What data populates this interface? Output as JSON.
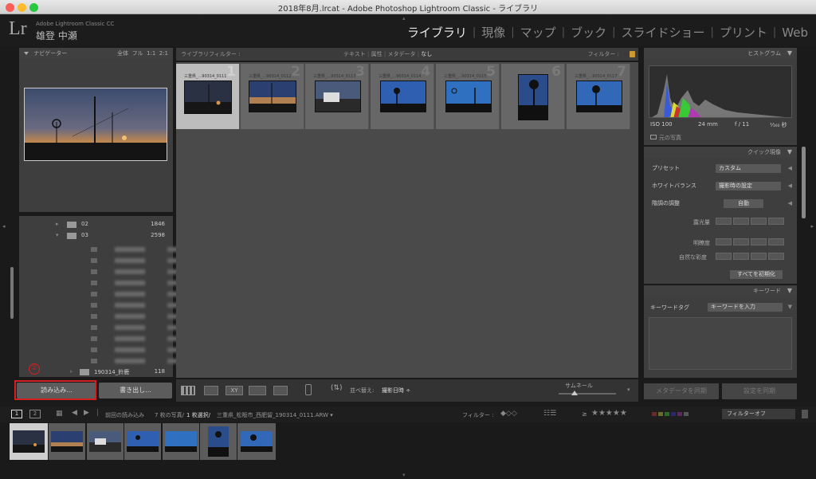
{
  "window": {
    "title": "2018年8月.lrcat - Adobe Photoshop Lightroom Classic - ライブラリ"
  },
  "identity": {
    "logo": "Lr",
    "product": "Adobe Lightroom Classic CC",
    "user": "雄登 中瀬"
  },
  "modules": [
    "ライブラリ",
    "現像",
    "マップ",
    "ブック",
    "スライドショー",
    "プリント",
    "Web"
  ],
  "navigator": {
    "title": "ナビゲーター",
    "zoom": [
      "全体",
      "フル",
      "1:1",
      "2:1"
    ]
  },
  "folders": [
    {
      "name": "02",
      "count": "1846"
    },
    {
      "name": "03",
      "count": "2598"
    }
  ],
  "folder_last": {
    "name": "190314_鈴鹿",
    "count": "118"
  },
  "annotation": {
    "marker": "①"
  },
  "left_buttons": {
    "import": "読み込み...",
    "export": "書き出し..."
  },
  "filter_bar": {
    "label": "ライブラリフィルター :",
    "tabs": [
      "テキスト",
      "属性",
      "メタデータ",
      "なし"
    ],
    "preset": "フィルター :"
  },
  "grid": [
    {
      "num": "1",
      "file": "三重県_...90314_0111"
    },
    {
      "num": "2",
      "file": "三重県_...90314_0112"
    },
    {
      "num": "3",
      "file": "三重県_...90314_0113"
    },
    {
      "num": "4",
      "file": "三重県_...90314_0114"
    },
    {
      "num": "5",
      "file": "三重県_...90314_0115"
    },
    {
      "num": "6",
      "file": "三...14_0116"
    },
    {
      "num": "7",
      "file": "三重県_...90314_0117"
    }
  ],
  "toolbar": {
    "sort_label": "並べ替え:",
    "sort_value": "撮影日時 ÷",
    "thumb_label": "サムネール"
  },
  "histogram": {
    "title": "ヒストグラム",
    "iso": "ISO 100",
    "focal": "24 mm",
    "aperture": "f / 11",
    "shutter": "¹⁄₁₆₀ 秒",
    "original": "元の写真"
  },
  "quick_develop": {
    "title": "クイック現像",
    "preset_label": "プリセット",
    "preset_value": "カスタム",
    "wb_label": "ホワイトバランス",
    "wb_value": "撮影時の設定",
    "tone_label": "階調の調整",
    "tone_auto": "自動",
    "exposure": "露光量",
    "clarity": "明瞭度",
    "vibrance": "自然な彩度",
    "reset": "すべてを初期化"
  },
  "keywords": {
    "title": "キーワード",
    "tag_label": "キーワードタグ",
    "tag_value": "キーワードを入力"
  },
  "right_buttons": {
    "sync_meta": "メタデータを同期",
    "sync_settings": "設定を同期"
  },
  "filmstrip": {
    "page1": "1",
    "page2": "2",
    "source": "前回の読み込み",
    "count": "7 枚の写真/",
    "selected": "1 枚選択/",
    "path": "三重県_松阪市_西肥留_190314_0111.ARW ▾",
    "filter_label": "フィルター :",
    "ge": "≥",
    "stars": "★★★★★",
    "filter_off": "フィルターオフ"
  },
  "colors": {
    "accent_red": "#d42020",
    "module_active": "#e8e8e8",
    "panel": "#3e3e3e",
    "grid_bg": "#4a4a4a"
  }
}
